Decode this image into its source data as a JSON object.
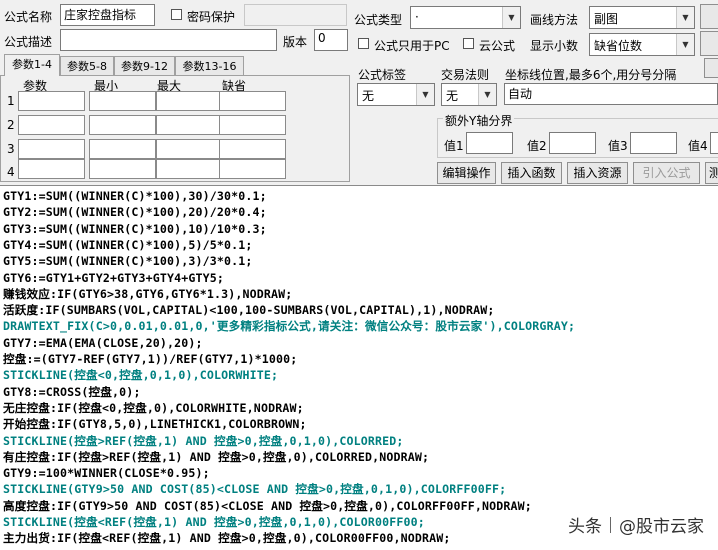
{
  "form": {
    "name_label": "公式名称",
    "name_value": "庄家控盘指标",
    "password_label": "密码保护",
    "desc_label": "公式描述",
    "version_label": "版本",
    "version_value": "0",
    "type_label": "公式类型",
    "type_value": "·",
    "draw_label": "画线方法",
    "draw_value": "副图",
    "pc_only_label": "公式只用于PC",
    "cloud_label": "云公式",
    "decimals_label": "显示小数",
    "decimals_value": "缺省位数",
    "tag_label": "公式标签",
    "tag_value": "无",
    "trade_label": "交易法则",
    "trade_value": "无",
    "coord_label": "坐标线位置,最多6个,用分号分隔",
    "coord_value": "自动",
    "yaxis_label": "额外Y轴分界",
    "val1": "值1",
    "val2": "值2",
    "val3": "值3",
    "val4": "值4"
  },
  "tabs": [
    "参数1-4",
    "参数5-8",
    "参数9-12",
    "参数13-16"
  ],
  "params": {
    "headers": [
      "参数",
      "最小",
      "最大",
      "缺省"
    ],
    "rows": [
      "1",
      "2",
      "3",
      "4"
    ]
  },
  "buttons": {
    "edit": "编辑操作",
    "insert_func": "插入函数",
    "insert_res": "插入资源",
    "import": "引入公式",
    "test": "测"
  },
  "code": [
    "GTY1:=SUM((WINNER(C)*100),30)/30*0.1;",
    "GTY2:=SUM((WINNER(C)*100),20)/20*0.4;",
    "GTY3:=SUM((WINNER(C)*100),10)/10*0.3;",
    "GTY4:=SUM((WINNER(C)*100),5)/5*0.1;",
    "GTY5:=SUM((WINNER(C)*100),3)/3*0.1;",
    "GTY6:=GTY1+GTY2+GTY3+GTY4+GTY5;",
    "赚钱效应:IF(GTY6>38,GTY6,GTY6*1.3),NODRAW;",
    "活跃度:IF(SUMBARS(VOL,CAPITAL)<100,100-SUMBARS(VOL,CAPITAL),1),NODRAW;",
    "DRAWTEXT_FIX(C>0,0.01,0.01,0,'更多精彩指标公式,请关注：微信公众号：股市云家'),COLORGRAY;",
    "GTY7:=EMA(EMA(CLOSE,20),20);",
    "控盘:=(GTY7-REF(GTY7,1))/REF(GTY7,1)*1000;",
    "STICKLINE(控盘<0,控盘,0,1,0),COLORWHITE;",
    "GTY8:=CROSS(控盘,0);",
    "无庄控盘:IF(控盘<0,控盘,0),COLORWHITE,NODRAW;",
    "开始控盘:IF(GTY8,5,0),LINETHICK1,COLORBROWN;",
    "STICKLINE(控盘>REF(控盘,1) AND 控盘>0,控盘,0,1,0),COLORRED;",
    "有庄控盘:IF(控盘>REF(控盘,1) AND 控盘>0,控盘,0),COLORRED,NODRAW;",
    "GTY9:=100*WINNER(CLOSE*0.95);",
    "STICKLINE(GTY9>50 AND COST(85)<CLOSE AND 控盘>0,控盘,0,1,0),COLORFF00FF;",
    "高度控盘:IF(GTY9>50 AND COST(85)<CLOSE AND 控盘>0,控盘,0),COLORFF00FF,NODRAW;",
    "STICKLINE(控盘<REF(控盘,1) AND 控盘>0,控盘,0,1,0),COLOR00FF00;",
    "主力出货:IF(控盘<REF(控盘,1) AND 控盘>0,控盘,0),COLOR00FF00,NODRAW;"
  ],
  "watermark": {
    "source": "头条",
    "author": "@股市云家"
  }
}
